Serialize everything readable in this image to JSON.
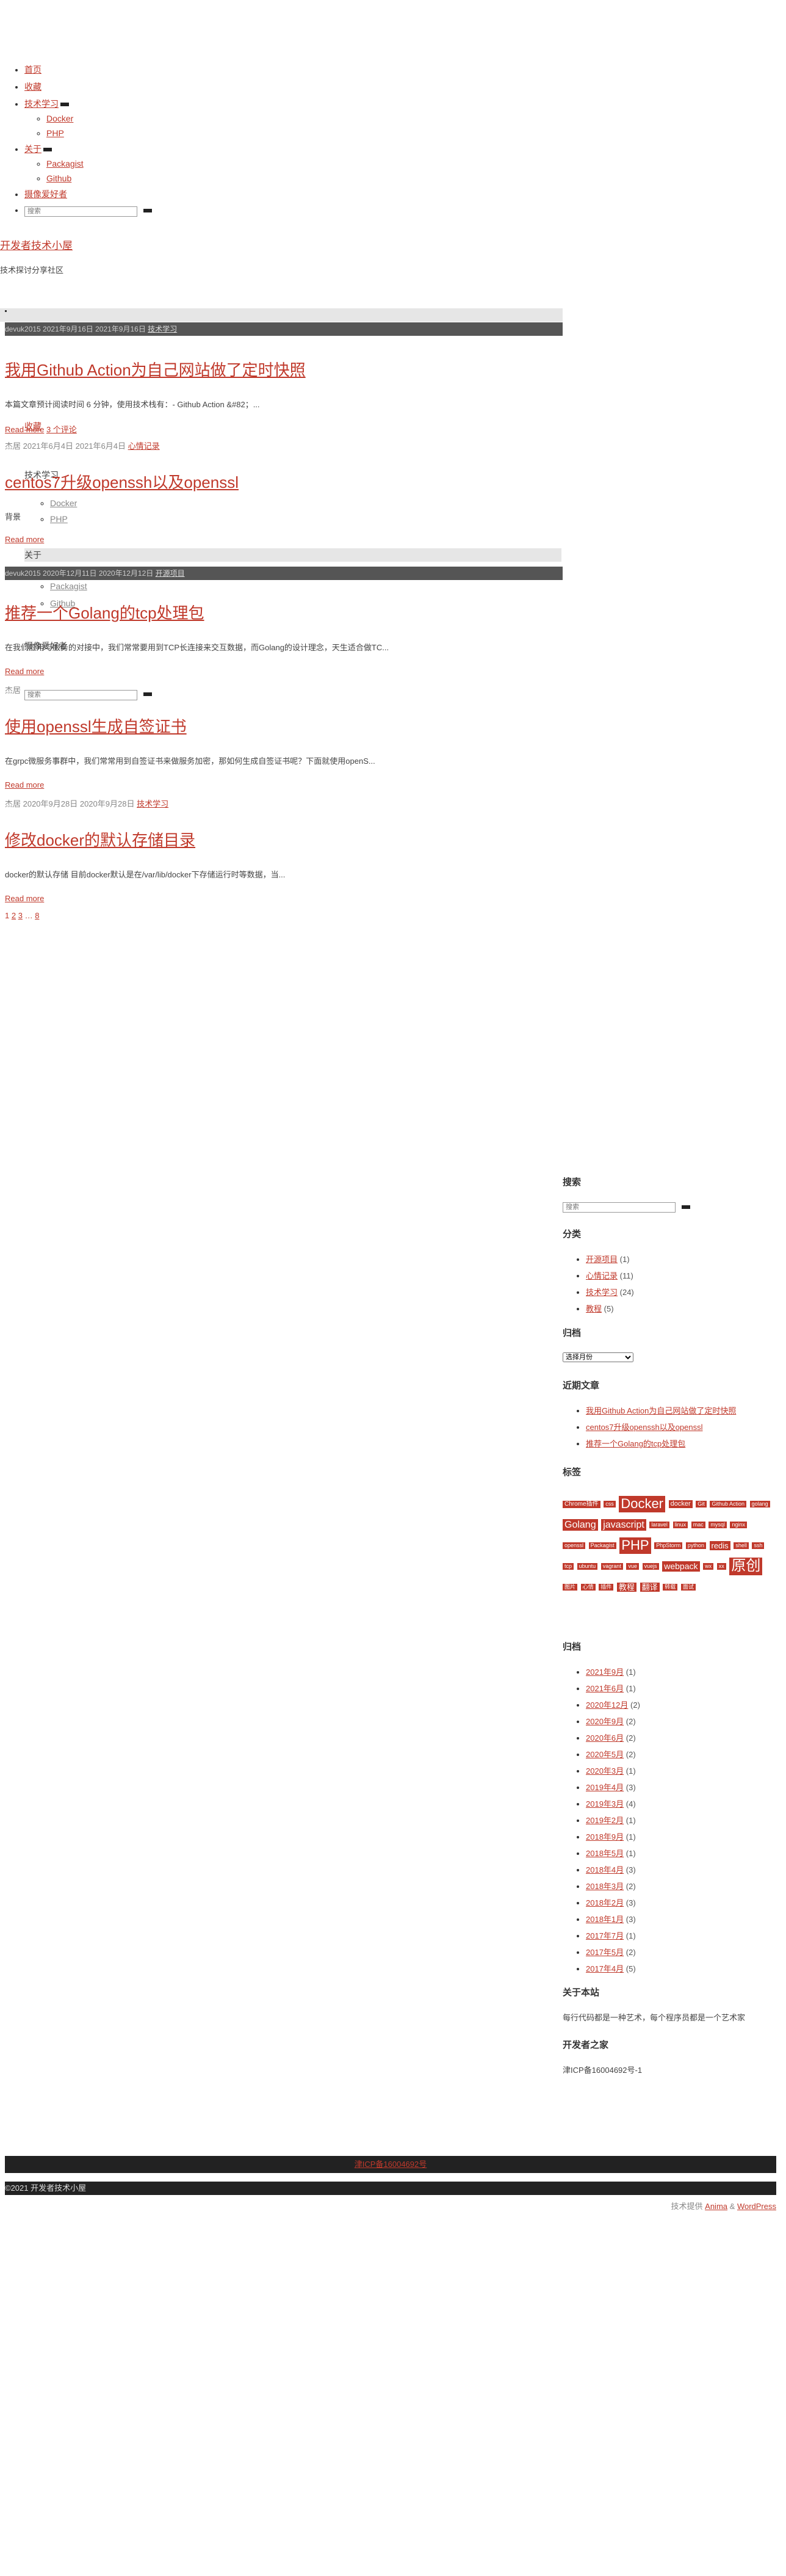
{
  "nav": {
    "home": "首页",
    "collection": "收藏",
    "tech": "技术学习",
    "tech_sub": [
      "Docker",
      "PHP"
    ],
    "about": "关于",
    "about_sub": [
      "Packagist",
      "Github"
    ],
    "photography": "摄像爱好者",
    "search_placeholder": "搜索"
  },
  "overlay_nav": {
    "collection": "收藏",
    "tech": "技术学习",
    "tech_sub": [
      "Docker",
      "PHP"
    ],
    "about": "关于",
    "about_sub": [
      "Packagist",
      "Github"
    ],
    "photography": "摄像爱好者",
    "search_placeholder": "搜索"
  },
  "site": {
    "title": "开发者技术小屋",
    "description": "技术探讨分享社区"
  },
  "posts": [
    {
      "meta_bar": "devuk2015 2021年9月16日 2021年9月16日",
      "meta_bar_category": "技术学习",
      "title": "我用Github Action为自己网站做了定时快照",
      "excerpt": "本篇文章预计阅读时间 6 分钟，使用技术栈有：- Github Action &#82；...",
      "read_more": "Read more",
      "comments": "3 个评论",
      "meta": "杰居 2021年6月4日 2021年6月4日",
      "meta_category": "心情记录"
    },
    {
      "title": "centos7升级openssh以及openssl",
      "excerpt_label": "背景",
      "read_more": "Read more",
      "meta_bar": "devuk2015 2020年12月11日 2020年12月12日",
      "meta_bar_category": "开源项目"
    },
    {
      "title": "推荐一个Golang的tcp处理包",
      "excerpt": "在我们应用与服务的对接中，我们常常要用到TCP长连接来交互数据，而Golang的设计理念，天生适合做TC...",
      "read_more": "Read more",
      "meta_prefix": "杰居"
    },
    {
      "title": "使用openssl生成自签证书",
      "excerpt": "在grpc微服务事群中，我们常常用到自签证书来做服务加密，那如何生成自签证书呢？下面就使用openS...",
      "read_more": "Read more",
      "meta": "杰居 2020年9月28日 2020年9月28日",
      "meta_category": "技术学习"
    },
    {
      "title": "修改docker的默认存储目录",
      "excerpt": "docker的默认存储 目前docker默认是在/var/lib/docker下存储运行时等数据，当...",
      "read_more": "Read more"
    }
  ],
  "pagination": [
    "1",
    "2",
    "3",
    "…",
    "8"
  ],
  "sidebar": {
    "search_title": "搜索",
    "search_placeholder": "搜索",
    "categories_title": "分类",
    "categories": [
      {
        "name": "开源项目",
        "count": "(1)"
      },
      {
        "name": "心情记录",
        "count": "(11)"
      },
      {
        "name": "技术学习",
        "count": "(24)"
      },
      {
        "name": "教程",
        "count": "(5)"
      }
    ],
    "archive_title": "归档",
    "archive_select": "选择月份",
    "recent_title": "近期文章",
    "recent": [
      "我用Github Action为自己网站做了定时快照",
      "centos7升级openssh以及openssl",
      "推荐一个Golang的tcp处理包"
    ],
    "tags_title": "标签",
    "tags": [
      {
        "name": "Chrome插件",
        "size": 10
      },
      {
        "name": "css",
        "size": 9
      },
      {
        "name": "Docker",
        "size": 22
      },
      {
        "name": "docker",
        "size": 11
      },
      {
        "name": "Git",
        "size": 9
      },
      {
        "name": "Github Action",
        "size": 9
      },
      {
        "name": "golang",
        "size": 9
      },
      {
        "name": "Golang",
        "size": 16
      },
      {
        "name": "javascript",
        "size": 16
      },
      {
        "name": "laravel",
        "size": 9
      },
      {
        "name": "linux",
        "size": 9
      },
      {
        "name": "mac",
        "size": 9
      },
      {
        "name": "mysql",
        "size": 9
      },
      {
        "name": "nginx",
        "size": 9
      },
      {
        "name": "openssl",
        "size": 9
      },
      {
        "name": "Packagist",
        "size": 9
      },
      {
        "name": "PHP",
        "size": 22
      },
      {
        "name": "PhpStorm",
        "size": 9
      },
      {
        "name": "python",
        "size": 9
      },
      {
        "name": "redis",
        "size": 13
      },
      {
        "name": "shell",
        "size": 9
      },
      {
        "name": "ssh",
        "size": 9
      },
      {
        "name": "tcp",
        "size": 9
      },
      {
        "name": "ubuntu",
        "size": 9
      },
      {
        "name": "vagrant",
        "size": 9
      },
      {
        "name": "vue",
        "size": 9
      },
      {
        "name": "vuejs",
        "size": 9
      },
      {
        "name": "webpack",
        "size": 14
      },
      {
        "name": "wx",
        "size": 9
      },
      {
        "name": "xx",
        "size": 9
      },
      {
        "name": "原创",
        "size": 24
      },
      {
        "name": "图片",
        "size": 9
      },
      {
        "name": "心情",
        "size": 9
      },
      {
        "name": "插件",
        "size": 9
      },
      {
        "name": "教程",
        "size": 13
      },
      {
        "name": "翻译",
        "size": 13
      },
      {
        "name": "转载",
        "size": 9
      },
      {
        "name": "面试",
        "size": 9
      }
    ],
    "archive2_title": "归档",
    "archives": [
      {
        "name": "2021年9月",
        "count": "(1)"
      },
      {
        "name": "2021年6月",
        "count": "(1)"
      },
      {
        "name": "2020年12月",
        "count": "(2)"
      },
      {
        "name": "2020年9月",
        "count": "(2)"
      },
      {
        "name": "2020年6月",
        "count": "(2)"
      },
      {
        "name": "2020年5月",
        "count": "(2)"
      },
      {
        "name": "2020年3月",
        "count": "(1)"
      },
      {
        "name": "2019年4月",
        "count": "(3)"
      },
      {
        "name": "2019年3月",
        "count": "(4)"
      },
      {
        "name": "2019年2月",
        "count": "(1)"
      },
      {
        "name": "2018年9月",
        "count": "(1)"
      },
      {
        "name": "2018年5月",
        "count": "(1)"
      },
      {
        "name": "2018年4月",
        "count": "(3)"
      },
      {
        "name": "2018年3月",
        "count": "(2)"
      },
      {
        "name": "2018年2月",
        "count": "(3)"
      },
      {
        "name": "2018年1月",
        "count": "(3)"
      },
      {
        "name": "2017年7月",
        "count": "(1)"
      },
      {
        "name": "2017年5月",
        "count": "(2)"
      },
      {
        "name": "2017年4月",
        "count": "(5)"
      }
    ],
    "about_title": "关于本站",
    "about_text": "每行代码都是一种艺术，每个程序员都是一个艺术家",
    "home_title": "开发者之家",
    "icp": "津ICP备16004692号-1"
  },
  "footer": {
    "icp": "津ICP备16004692号",
    "copyright": "©2021 开发者技术小屋",
    "credit_prefix": "技术提供",
    "credit_theme": "Anima",
    "credit_sep": "&",
    "credit_wp": "WordPress"
  }
}
